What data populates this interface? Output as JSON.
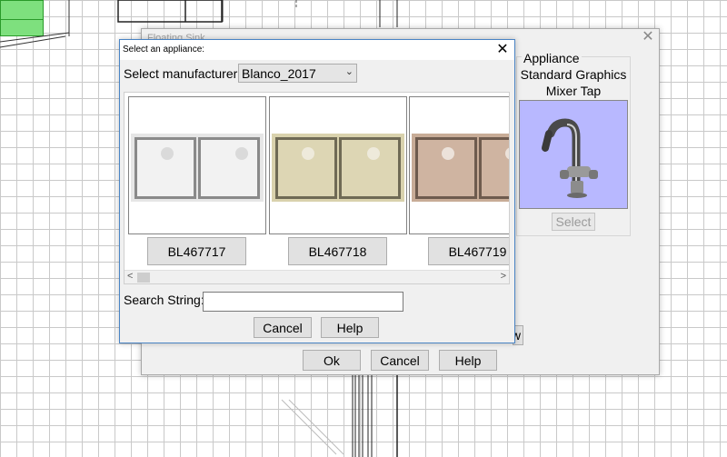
{
  "background_dialog": {
    "title": "Floating Sink",
    "appliance": {
      "heading": "Appliance",
      "name_line1": "Standard Graphics",
      "name_line2": "Mixer Tap",
      "select_label": "Select"
    },
    "partial_button_label": "w",
    "ok_label": "Ok",
    "cancel_label": "Cancel",
    "help_label": "Help"
  },
  "select_dialog": {
    "title": "Select an appliance:",
    "manufacturer_label": "Select manufacturer:",
    "manufacturer_value": "Blanco_2017",
    "items": [
      {
        "label": "BL467717",
        "color": "#e6e6e6",
        "bowl_color": "#f2f2f2",
        "border_color": "#8a8a8a"
      },
      {
        "label": "BL467718",
        "color": "#d9d2ad",
        "bowl_color": "#ddd6b4",
        "border_color": "#6f6a55"
      },
      {
        "label": "BL467719",
        "color": "#c8ac97",
        "bowl_color": "#cfb4a1",
        "border_color": "#6e5b4e"
      }
    ],
    "search_label": "Search String:",
    "search_value": "",
    "cancel_label": "Cancel",
    "help_label": "Help"
  },
  "colors": {
    "preview_bg": "#b8b8ff",
    "dialog_bg": "#f0f0f0",
    "grid_line": "#c9c9c9"
  }
}
